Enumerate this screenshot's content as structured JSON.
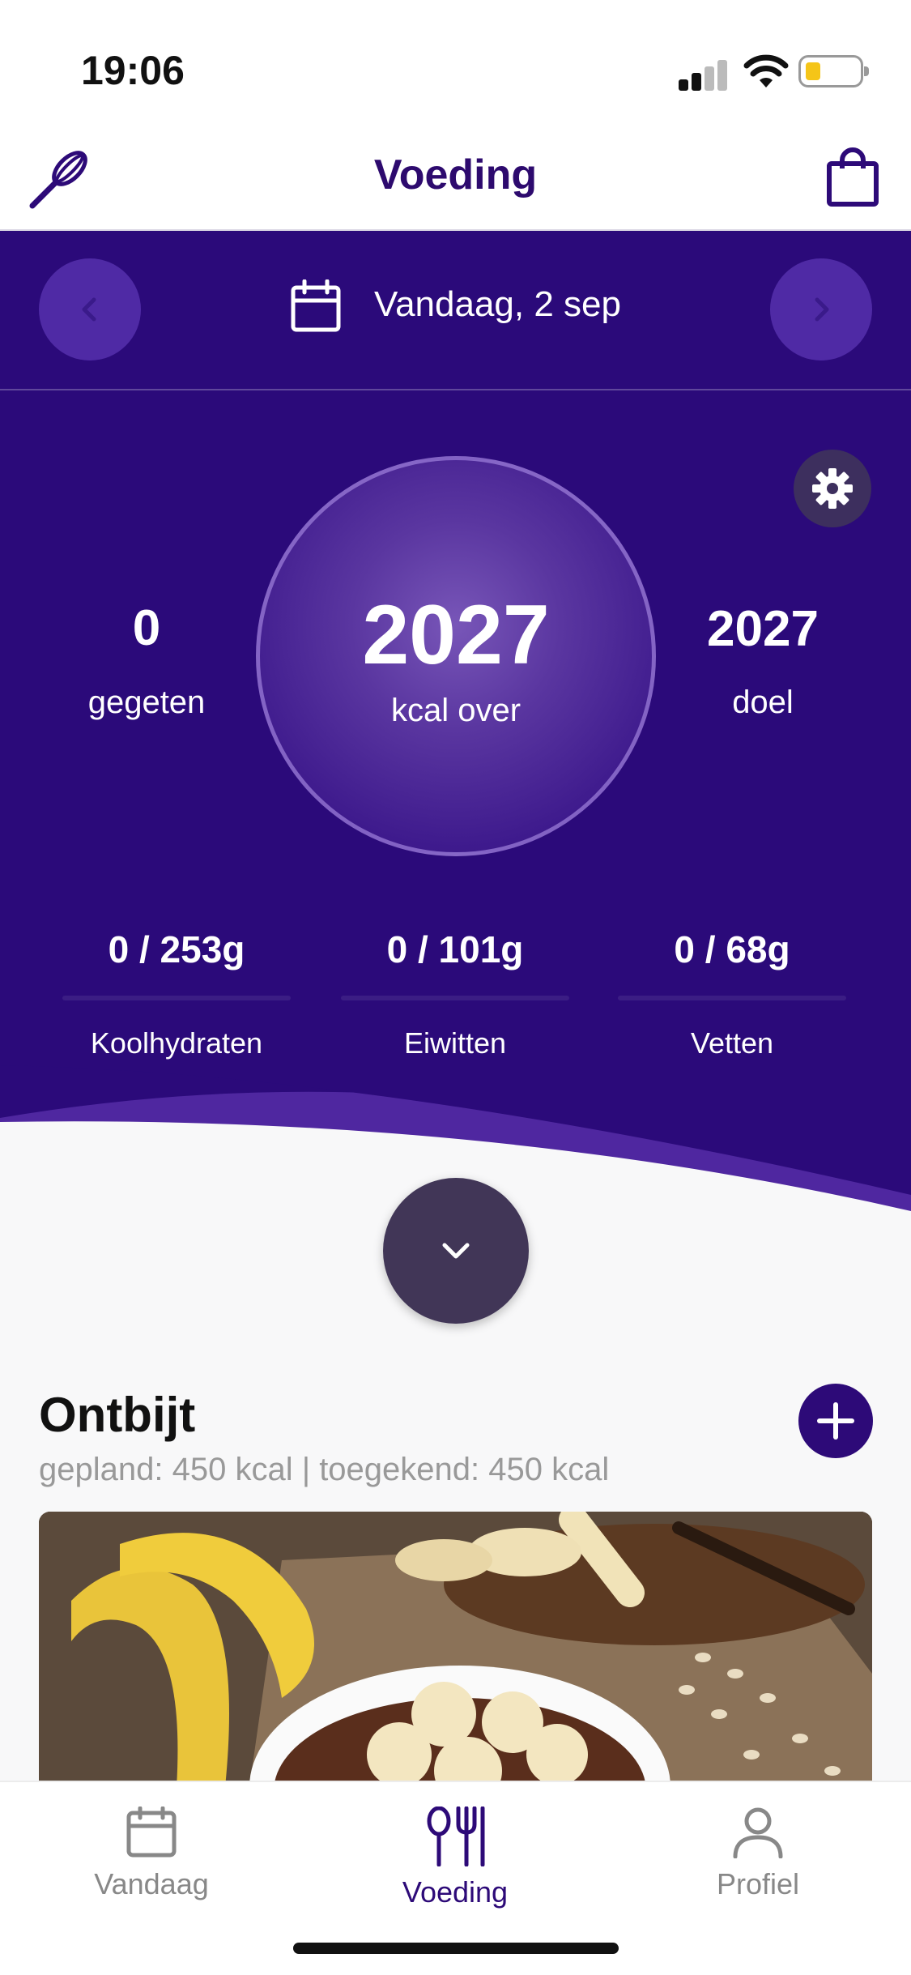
{
  "status_bar": {
    "time": "19:06"
  },
  "navbar": {
    "title": "Voeding",
    "left_icon": "whisk-icon",
    "right_icon": "shopping-bag-icon"
  },
  "date_nav": {
    "label": "Vandaag, 2 sep",
    "prev_icon": "chevron-left-icon",
    "next_icon": "chevron-right-icon"
  },
  "summary": {
    "eaten_value": "0",
    "eaten_label": "gegeten",
    "remaining_value": "2027",
    "remaining_label": "kcal over",
    "goal_value": "2027",
    "goal_label": "doel"
  },
  "macros": [
    {
      "value": "0 / 253g",
      "label": "Koolhydraten",
      "progress": 0
    },
    {
      "value": "0 / 101g",
      "label": "Eiwitten",
      "progress": 0
    },
    {
      "value": "0 / 68g",
      "label": "Vetten",
      "progress": 0
    }
  ],
  "meal": {
    "title": "Ontbijt",
    "subtitle": "gepland: 450 kcal | toegekend: 450 kcal"
  },
  "tabs": [
    {
      "label": "Vandaag",
      "active": false
    },
    {
      "label": "Voeding",
      "active": true
    },
    {
      "label": "Profiel",
      "active": false
    }
  ],
  "colors": {
    "brand_purple": "#2d0a78",
    "header_bg": "#2b0a7a",
    "inactive_tab": "#888888"
  }
}
